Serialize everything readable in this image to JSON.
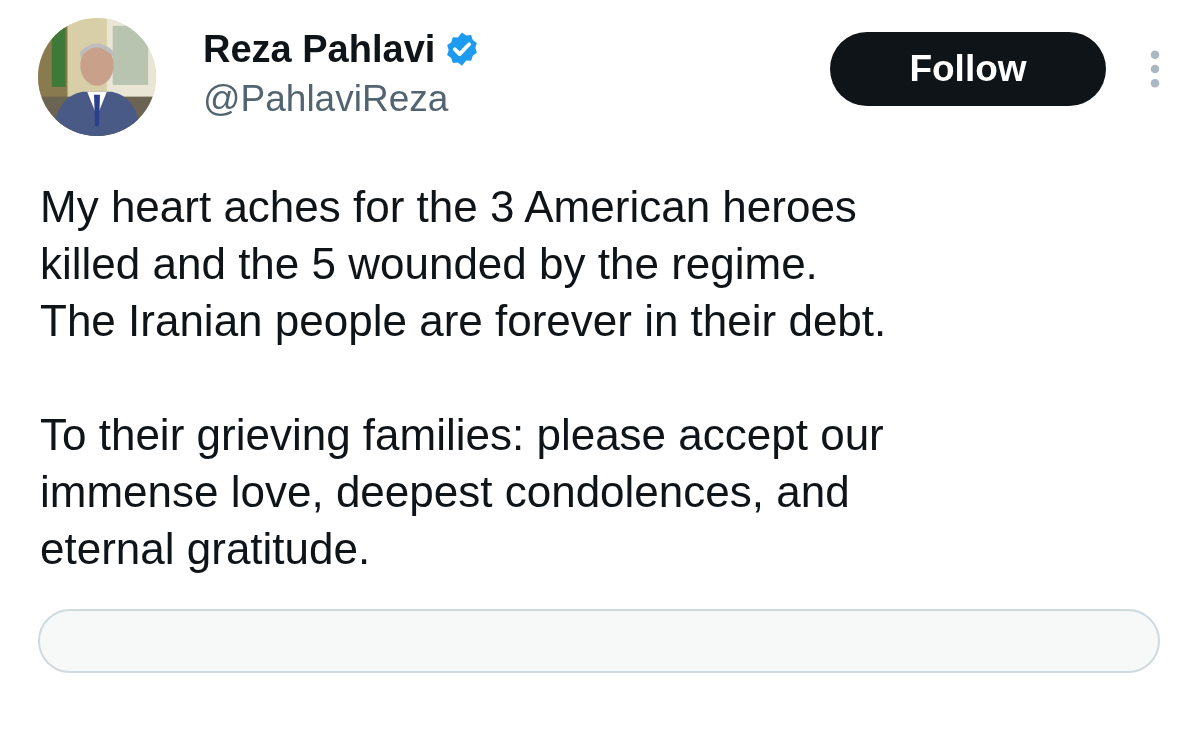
{
  "author": {
    "name": "Reza Pahlavi",
    "verified": true,
    "handle": "@PahlaviReza"
  },
  "follow_button": {
    "label": "Follow"
  },
  "tweet": {
    "paragraphs": [
      {
        "lines": [
          "My heart aches for the 3 American heroes",
          "killed and the 5 wounded by the regime.",
          "The Iranian people are forever in their debt."
        ]
      },
      {
        "lines": [
          "To their grieving families: please accept our",
          "immense love, deepest condolences, and",
          "eternal gratitude."
        ]
      }
    ]
  },
  "card": {
    "kind": "preview"
  }
}
